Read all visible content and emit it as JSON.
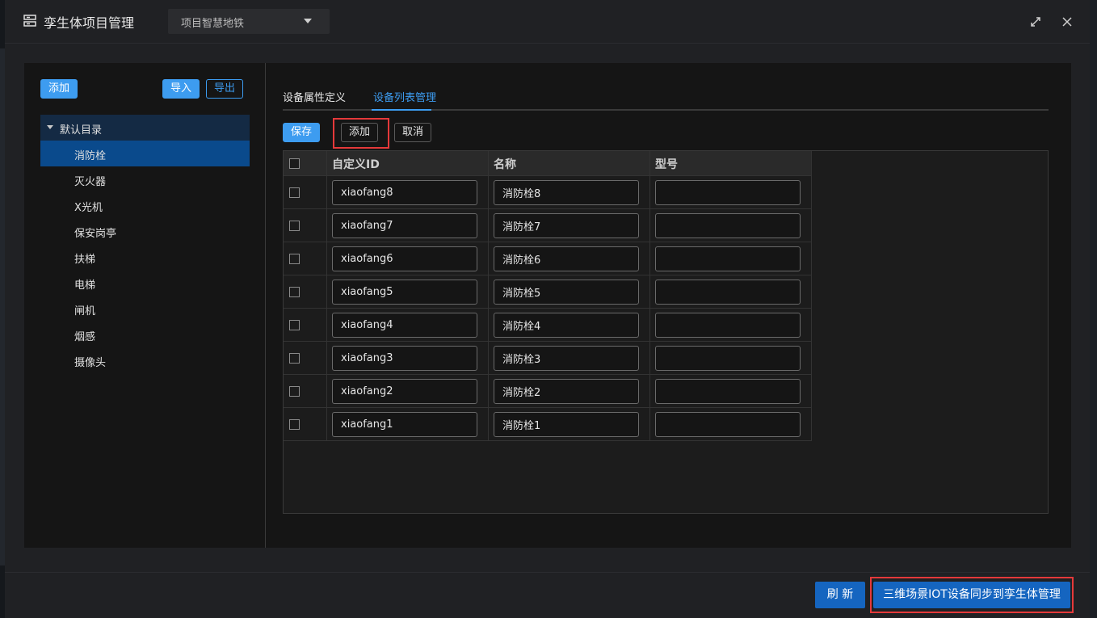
{
  "dialog": {
    "title": "孪生体项目管理",
    "project_select": "项目智慧地铁"
  },
  "left": {
    "add_label": "添加",
    "import_label": "导入",
    "export_label": "导出",
    "tree_root": "默认目录",
    "items": [
      {
        "label": "消防栓",
        "active": true
      },
      {
        "label": "灭火器"
      },
      {
        "label": "X光机"
      },
      {
        "label": "保安岗亭"
      },
      {
        "label": "扶梯"
      },
      {
        "label": "电梯"
      },
      {
        "label": "闸机"
      },
      {
        "label": "烟感"
      },
      {
        "label": "摄像头"
      }
    ]
  },
  "tabs": {
    "attr_def": "设备属性定义",
    "list_mgmt": "设备列表管理"
  },
  "toolbar": {
    "save_label": "保存",
    "add_label": "添加",
    "cancel_label": "取消"
  },
  "table": {
    "headers": [
      "自定义ID",
      "名称",
      "型号"
    ],
    "rows": [
      {
        "id": "xiaofang8",
        "name": "消防栓8",
        "model": ""
      },
      {
        "id": "xiaofang7",
        "name": "消防栓7",
        "model": ""
      },
      {
        "id": "xiaofang6",
        "name": "消防栓6",
        "model": ""
      },
      {
        "id": "xiaofang5",
        "name": "消防栓5",
        "model": ""
      },
      {
        "id": "xiaofang4",
        "name": "消防栓4",
        "model": ""
      },
      {
        "id": "xiaofang3",
        "name": "消防栓3",
        "model": ""
      },
      {
        "id": "xiaofang2",
        "name": "消防栓2",
        "model": ""
      },
      {
        "id": "xiaofang1",
        "name": "消防栓1",
        "model": ""
      }
    ]
  },
  "footer": {
    "refresh_label": "刷 新",
    "sync_label": "三维场景IOT设备同步到孪生体管理"
  },
  "colors": {
    "accent": "#3d9cf0",
    "highlight": "#e5393a",
    "footer_button": "#1565c0"
  }
}
